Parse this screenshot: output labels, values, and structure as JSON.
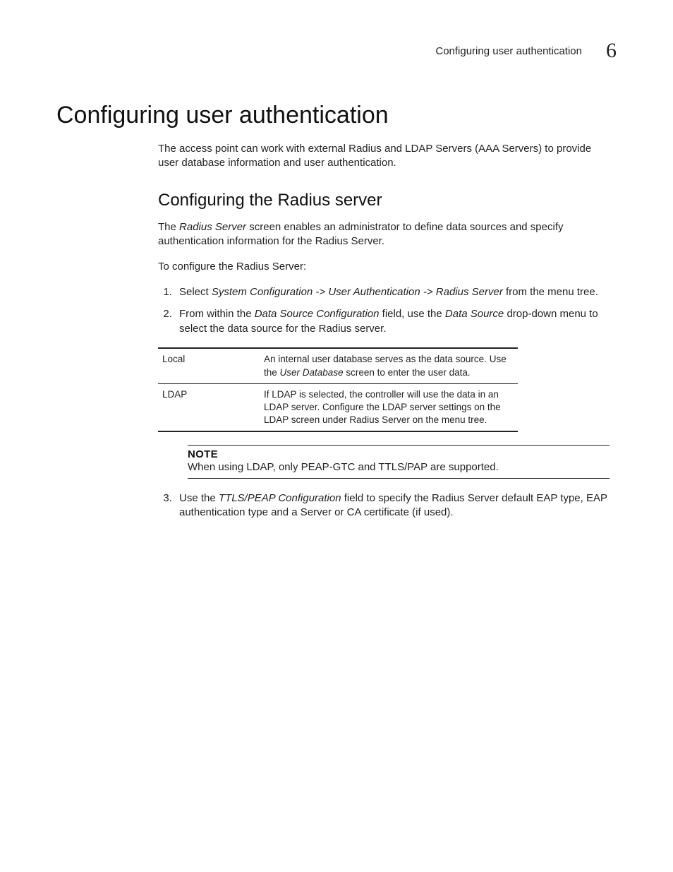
{
  "header": {
    "running_title": "Configuring user authentication",
    "chapter_number": "6"
  },
  "section": {
    "title": "Configuring user authentication",
    "intro": "The access point can work with external Radius and LDAP Servers (AAA Servers) to provide user database information and user authentication."
  },
  "subsection": {
    "title": "Configuring the Radius server",
    "para1_pre": "The ",
    "para1_em": "Radius Server",
    "para1_post": " screen enables an administrator to define data sources and specify authentication information for the Radius Server.",
    "para2": "To configure the Radius Server:",
    "step1_pre": "Select ",
    "step1_em": "System Configuration -> User Authentication -> Radius Server",
    "step1_post": " from the menu tree.",
    "step2_pre": "From within the ",
    "step2_em1": "Data Source Configuration",
    "step2_mid": " field, use the ",
    "step2_em2": "Data Source",
    "step2_post": " drop-down menu to select the data source for the Radius server.",
    "table": {
      "rows": [
        {
          "key": "Local",
          "val_pre": "An internal user database serves as the data source. Use the ",
          "val_em": "User Database",
          "val_post": " screen to enter the user data."
        },
        {
          "key": "LDAP",
          "val_pre": "If LDAP is selected, the controller will use the data in an LDAP server. Configure the LDAP server settings on the LDAP screen under Radius Server on the menu tree.",
          "val_em": "",
          "val_post": ""
        }
      ]
    },
    "note": {
      "label": "NOTE",
      "text": "When using LDAP, only PEAP-GTC and TTLS/PAP are supported."
    },
    "step3_pre": "Use the ",
    "step3_em": "TTLS/PEAP Configuration",
    "step3_post": " field to specify the Radius Server default EAP type, EAP authentication type and a Server or CA certificate (if used)."
  }
}
